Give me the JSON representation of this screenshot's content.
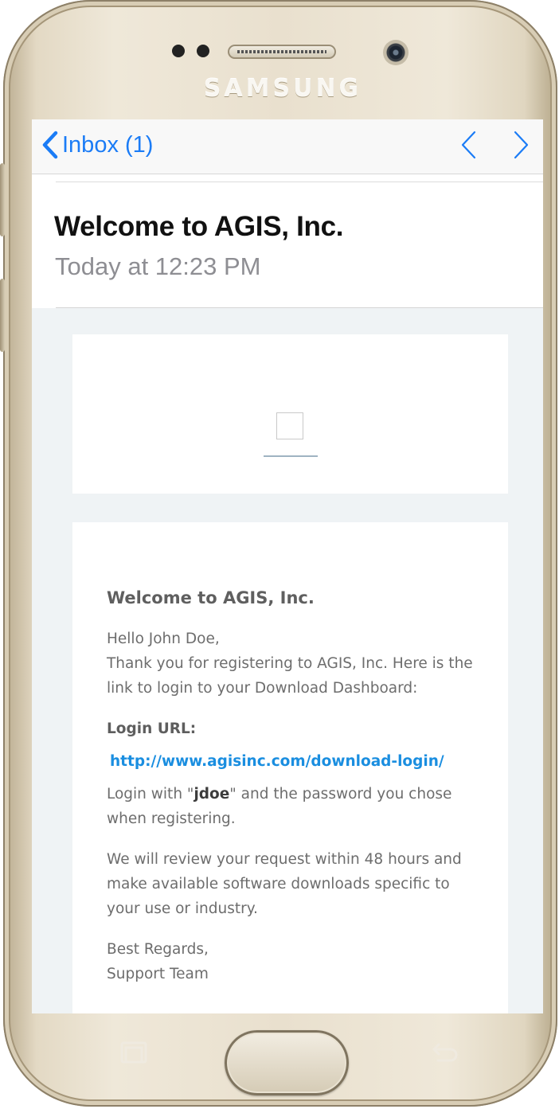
{
  "device": {
    "brand": "SAMSUNG"
  },
  "navbar": {
    "back_label": "Inbox (1)"
  },
  "email": {
    "subject": "Welcome to AGIS, Inc.",
    "date": "Today at 12:23 PM",
    "body": {
      "heading": "Welcome to AGIS, Inc.",
      "greeting": "Hello John Doe,",
      "intro": "Thank you for registering to AGIS, Inc.  Here is the link to login to your Download Dashboard:",
      "login_label": "Login URL:",
      "login_url": "http://www.agisinc.com/download-login/",
      "login_pre": "Login with \"",
      "username": "jdoe",
      "login_post": "\" and the password you chose when registering.",
      "review": "We will review your request within 48 hours and make available software downloads specific to your use or industry.",
      "closing": "Best Regards,",
      "signature": "Support Team"
    }
  },
  "colors": {
    "link": "#1a8ee0",
    "accent": "#1b7cf6",
    "mail_bg": "#eff3f5"
  },
  "icons": [
    "chevron-left-icon",
    "prev-arrow-icon",
    "next-arrow-icon",
    "recent-apps-icon",
    "back-icon"
  ]
}
